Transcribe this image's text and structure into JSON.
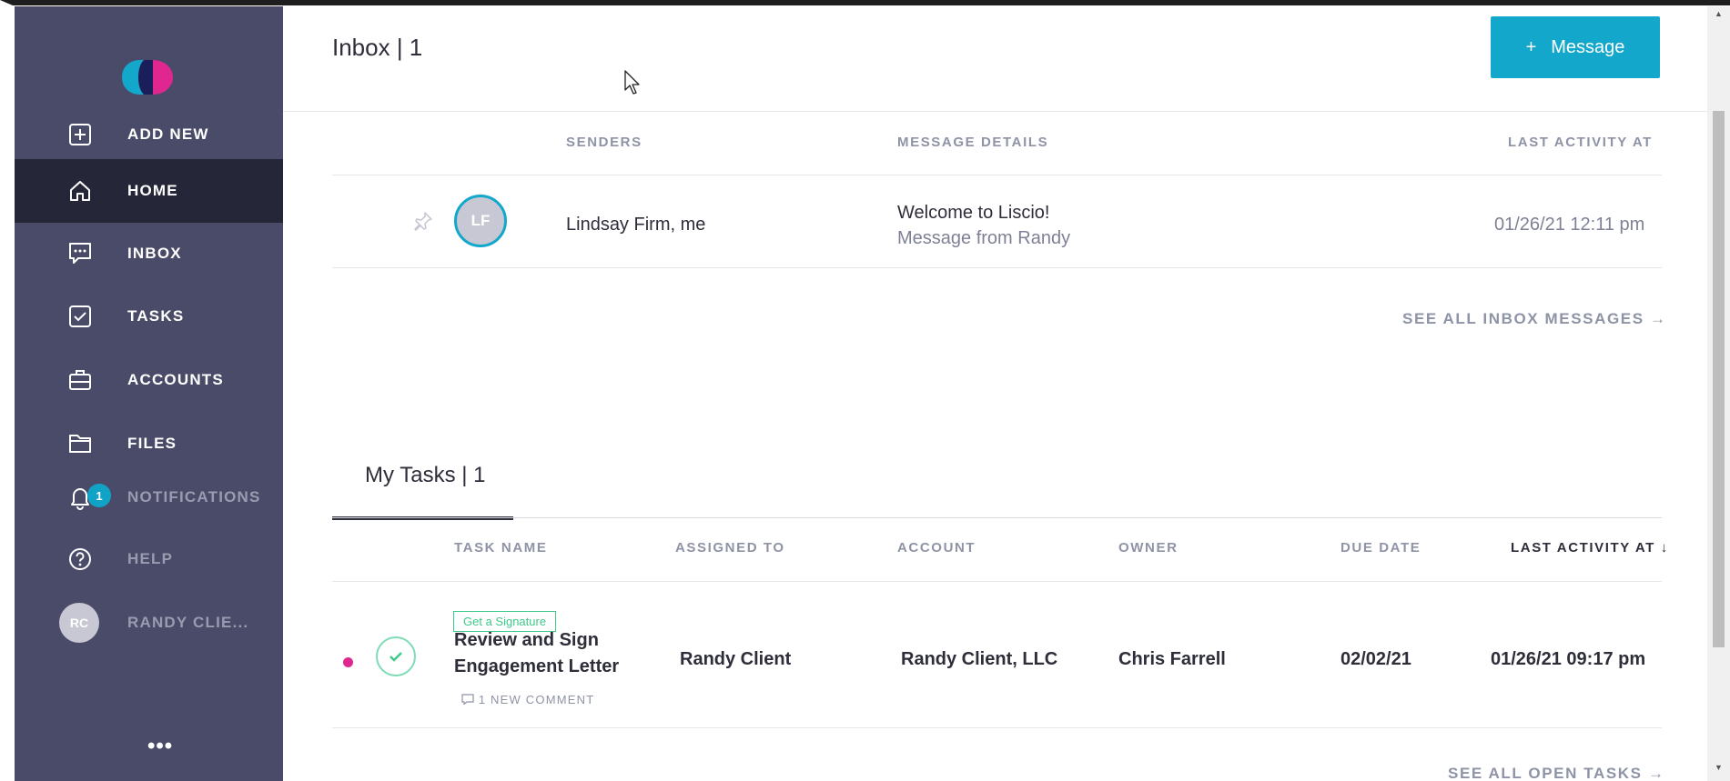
{
  "sidebar": {
    "items": [
      {
        "label": "ADD NEW",
        "icon": "plus-square-icon"
      },
      {
        "label": "HOME",
        "icon": "home-icon"
      },
      {
        "label": "INBOX",
        "icon": "chat-icon"
      },
      {
        "label": "TASKS",
        "icon": "checkbox-icon"
      },
      {
        "label": "ACCOUNTS",
        "icon": "briefcase-icon"
      },
      {
        "label": "FILES",
        "icon": "folder-icon"
      },
      {
        "label": "NOTIFICATIONS",
        "icon": "bell-icon"
      },
      {
        "label": "HELP",
        "icon": "help-circle-icon"
      },
      {
        "label": "RANDY CLIE...",
        "icon": "avatar"
      }
    ],
    "notifications_count": "1",
    "user_initials": "RC",
    "more_label": "•••"
  },
  "inbox": {
    "title": "Inbox | 1",
    "new_message_label": "Message",
    "new_message_plus": "+",
    "columns": {
      "senders": "SENDERS",
      "details": "MESSAGE DETAILS",
      "last_activity": "LAST ACTIVITY AT"
    },
    "rows": [
      {
        "initials": "LF",
        "senders": "Lindsay Firm, me",
        "subject": "Welcome to Liscio!",
        "preview": "Message from Randy",
        "last_activity": "01/26/21 12:11 pm"
      }
    ],
    "see_all": "SEE ALL INBOX MESSAGES →"
  },
  "tasks": {
    "tab_label": "My Tasks | 1",
    "columns": {
      "task_name": "TASK NAME",
      "assigned_to": "ASSIGNED TO",
      "account": "ACCOUNT",
      "owner": "OWNER",
      "due_date": "DUE DATE",
      "last_activity": "LAST ACTIVITY AT ↓"
    },
    "rows": [
      {
        "tag": "Get a Signature",
        "name_line1": "Review and Sign",
        "name_line2": "Engagement Letter",
        "comments": "1 NEW COMMENT",
        "assigned_to": "Randy Client",
        "account": "Randy Client, LLC",
        "owner": "Chris Farrell",
        "due_date": "02/02/21",
        "last_activity": "01/26/21 09:17 pm"
      }
    ],
    "see_all": "SEE ALL OPEN TASKS →"
  },
  "colors": {
    "sidebar": "#4a4b68",
    "sidebar_active": "#262639",
    "accent": "#13a8cb",
    "logo_pink": "#e0268f",
    "success": "#3fc98a"
  }
}
